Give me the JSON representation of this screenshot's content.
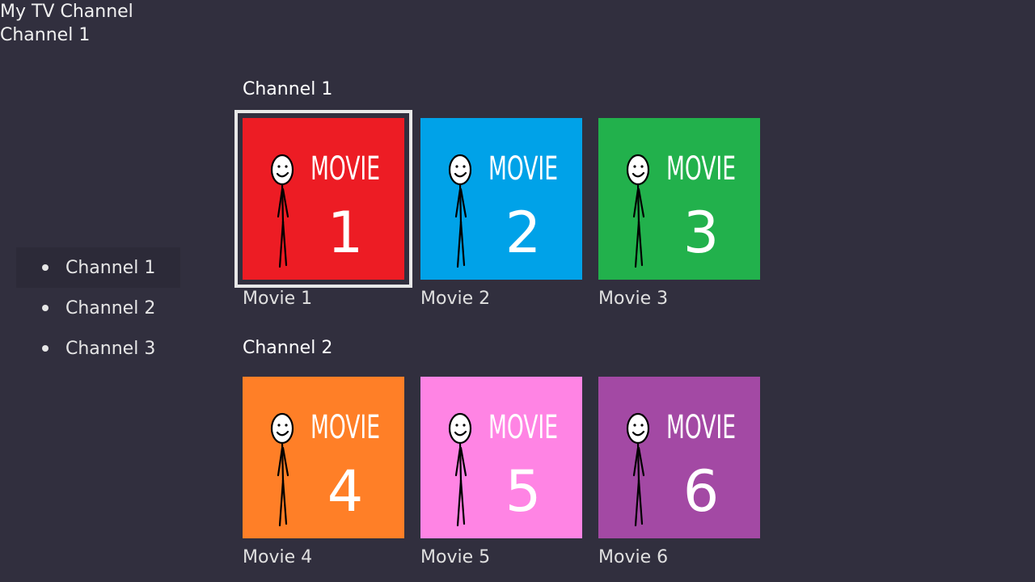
{
  "header": {
    "app_title": "My TV Channel",
    "current_channel": "Channel 1"
  },
  "sidebar": {
    "items": [
      {
        "label": "Channel 1",
        "active": true
      },
      {
        "label": "Channel 2",
        "active": false
      },
      {
        "label": "Channel 3",
        "active": false
      }
    ]
  },
  "rows": [
    {
      "title": "Channel 1",
      "tiles": [
        {
          "label": "Movie 1",
          "poster_word": "MOVIE",
          "poster_number": "1",
          "color": "#ed1c24",
          "focused": true
        },
        {
          "label": "Movie 2",
          "poster_word": "MOVIE",
          "poster_number": "2",
          "color": "#00a2e8",
          "focused": false
        },
        {
          "label": "Movie 3",
          "poster_word": "MOVIE",
          "poster_number": "3",
          "color": "#22b14c",
          "focused": false
        }
      ]
    },
    {
      "title": "Channel 2",
      "tiles": [
        {
          "label": "Movie 4",
          "poster_word": "MOVIE",
          "poster_number": "4",
          "color": "#ff7f27",
          "focused": false
        },
        {
          "label": "Movie 5",
          "poster_word": "MOVIE",
          "poster_number": "5",
          "color": "#ff84e4",
          "focused": false
        },
        {
          "label": "Movie 6",
          "poster_word": "MOVIE",
          "poster_number": "6",
          "color": "#a349a4",
          "focused": false
        }
      ]
    }
  ]
}
